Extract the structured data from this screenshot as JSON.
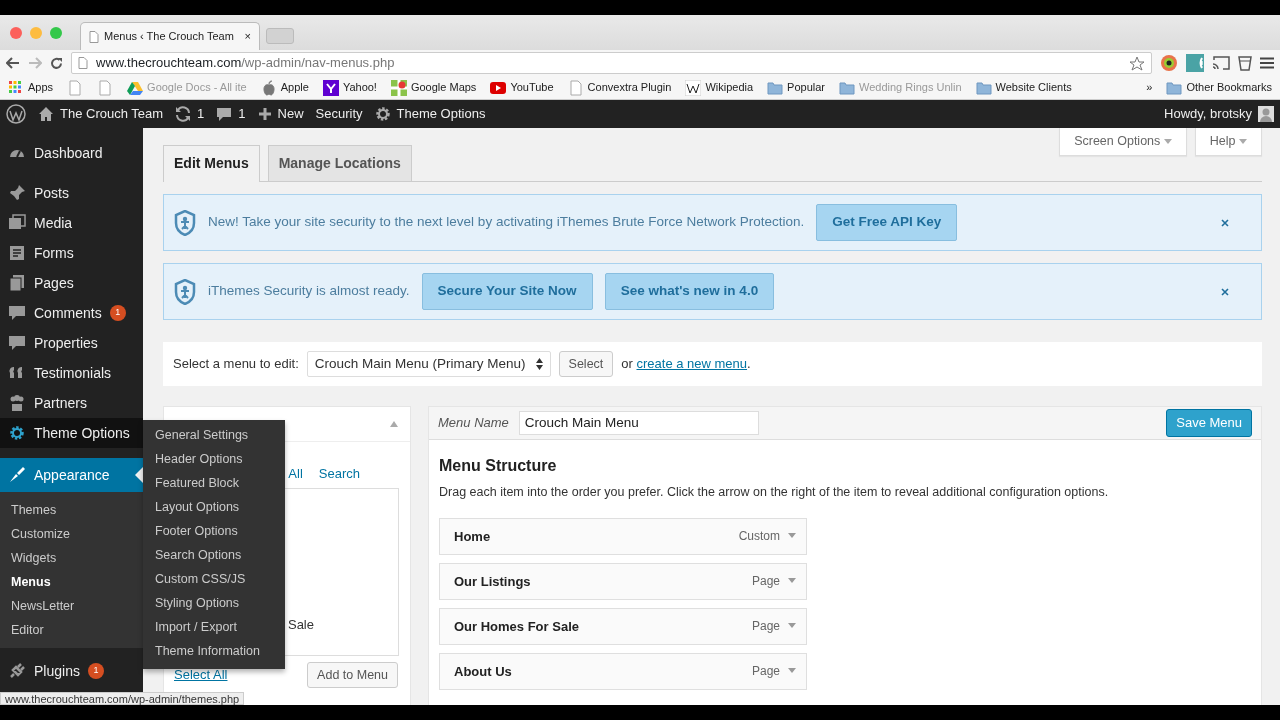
{
  "browser": {
    "tab_title": "Menus ‹ The Crouch Team",
    "tab_close": "×",
    "url_host": "www.thecrouchteam.com",
    "url_path": "/wp-admin/nav-menus.php",
    "bookmarks": [
      {
        "kind": "apps",
        "label": "Apps"
      },
      {
        "kind": "page"
      },
      {
        "kind": "page"
      },
      {
        "kind": "drive",
        "label": "Google Docs - All ite",
        "faded": true
      },
      {
        "kind": "apple",
        "label": "Apple"
      },
      {
        "kind": "yahoo",
        "label": "Yahoo!"
      },
      {
        "kind": "maps",
        "label": "Google Maps"
      },
      {
        "kind": "youtube",
        "label": "YouTube"
      },
      {
        "kind": "page",
        "label": "Convextra Plugin"
      },
      {
        "kind": "wiki",
        "label": "Wikipedia"
      },
      {
        "kind": "folder",
        "label": "Popular"
      },
      {
        "kind": "folder",
        "label": "Wedding Rings Unlin",
        "faded": true
      },
      {
        "kind": "folder",
        "label": "Website Clients"
      }
    ],
    "more": "»",
    "other": "Other Bookmarks"
  },
  "admin_bar": {
    "site": "The Crouch Team",
    "updates": "1",
    "comments": "1",
    "new": "New",
    "security": "Security",
    "theme_options": "Theme Options",
    "howdy": "Howdy, brotsky"
  },
  "sidebar": {
    "items": [
      {
        "label": "Dashboard",
        "selected": false,
        "hovered": false
      },
      {
        "label": "Posts",
        "selected": false,
        "hovered": false
      },
      {
        "label": "Media",
        "selected": false,
        "hovered": false
      },
      {
        "label": "Forms",
        "selected": false,
        "hovered": false
      },
      {
        "label": "Pages",
        "selected": false,
        "hovered": false
      },
      {
        "label": "Comments",
        "badge": "1",
        "selected": false,
        "hovered": false
      },
      {
        "label": "Properties",
        "selected": false,
        "hovered": false
      },
      {
        "label": "Testimonials",
        "selected": false,
        "hovered": false
      },
      {
        "label": "Partners",
        "selected": false,
        "hovered": false
      },
      {
        "label": "Theme Options",
        "selected": false,
        "hovered": true
      },
      {
        "label": "Appearance",
        "selected": true,
        "hovered": false,
        "children": [
          {
            "label": "Themes",
            "selected": false
          },
          {
            "label": "Customize",
            "selected": false
          },
          {
            "label": "Widgets",
            "selected": false
          },
          {
            "label": "Menus",
            "selected": true
          },
          {
            "label": "NewsLetter",
            "selected": false
          },
          {
            "label": "Editor",
            "selected": false
          }
        ]
      },
      {
        "label": "Plugins",
        "badge": "1",
        "selected": false,
        "hovered": false
      }
    ]
  },
  "flyout": [
    "General Settings",
    "Header Options",
    "Featured Block",
    "Layout Options",
    "Footer Options",
    "Search Options",
    "Custom CSS/JS",
    "Styling Options",
    "Import / Export",
    "Theme Information"
  ],
  "screen_tabs": [
    "Screen Options",
    "Help"
  ],
  "tabs": [
    {
      "label": "Edit Menus",
      "selected": true
    },
    {
      "label": "Manage Locations",
      "selected": false
    }
  ],
  "notices": [
    {
      "text": "New! Take your site security to the next level by activating iThemes Brute Force Network Protection.",
      "buttons": [
        "Get Free API Key"
      ]
    },
    {
      "text": "iThemes Security is almost ready.",
      "buttons": [
        "Secure Your Site Now",
        "See what's new in 4.0"
      ]
    }
  ],
  "select_bar": {
    "label": "Select a menu to edit:",
    "value": "Crouch Main Menu (Primary Menu)",
    "button": "Select",
    "or": "or",
    "link": "create a new menu",
    "end": "."
  },
  "pages_panel": {
    "tabs": [
      "All",
      "Search"
    ],
    "items": [
      "Sale"
    ],
    "select_all": "Select All",
    "add": "Add to Menu"
  },
  "menu_editor": {
    "name_label": "Menu Name",
    "name_value": "Crouch Main Menu",
    "save": "Save Menu",
    "heading": "Menu Structure",
    "description": "Drag each item into the order you prefer. Click the arrow on the right of the item to reveal additional configuration options.",
    "items": [
      {
        "title": "Home",
        "type": "Custom"
      },
      {
        "title": "Our Listings",
        "type": "Page"
      },
      {
        "title": "Our Homes For Sale",
        "type": "Page"
      },
      {
        "title": "About Us",
        "type": "Page"
      }
    ]
  },
  "status_url": "www.thecrouchteam.com/wp-admin/themes.php"
}
